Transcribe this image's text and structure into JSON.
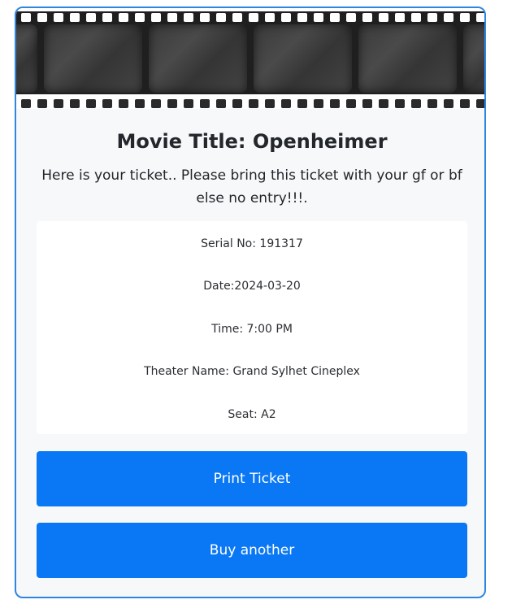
{
  "ticket": {
    "title": "Movie Title: Openheimer",
    "message": "Here is your ticket.. Please bring this ticket with your gf or bf else no entry!!!.",
    "details": {
      "serial": "Serial No: 191317",
      "date": "Date:2024-03-20",
      "time": "Time: 7:00 PM",
      "theater": "Theater Name: Grand Sylhet Cineplex",
      "seat": "Seat: A2"
    }
  },
  "actions": {
    "print_label": "Print Ticket",
    "buy_label": "Buy another"
  },
  "colors": {
    "accent": "#0a78f5",
    "border": "#2f86e0",
    "card_background": "#f7f8fa"
  },
  "banner": {
    "icon": "film-strip-image"
  }
}
